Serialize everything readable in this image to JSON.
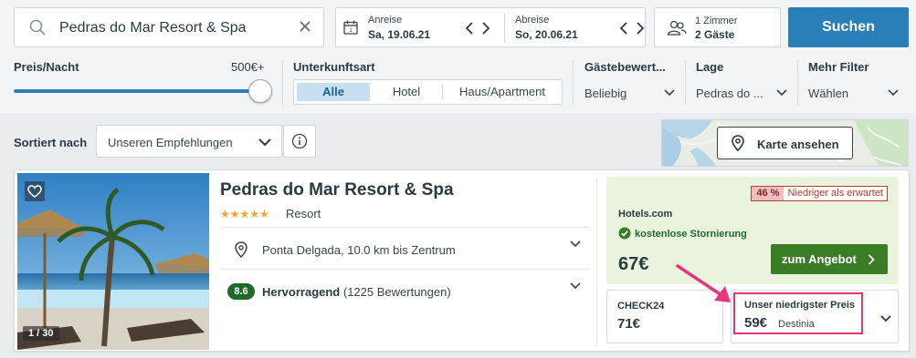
{
  "search": {
    "destination": "Pedras do Mar Resort & Spa",
    "checkin_label": "Anreise",
    "checkin_value": "Sa, 19.06.21",
    "checkout_label": "Abreise",
    "checkout_value": "So, 20.06.21",
    "rooms": "1 Zimmer",
    "guests": "2 Gäste",
    "button": "Suchen"
  },
  "filters": {
    "price_label": "Preis/Nacht",
    "price_value": "500€+",
    "price_level_percent": 100,
    "type_label": "Unterkunftsart",
    "type_options": [
      "Alle",
      "Hotel",
      "Haus/Apartment"
    ],
    "type_selected": "Alle",
    "rating_label": "Gästebewert...",
    "rating_value": "Beliebig",
    "location_label": "Lage",
    "location_value": "Pedras do ...",
    "more_label": "Mehr Filter",
    "more_value": "Wählen"
  },
  "results": {
    "sort_label": "Sortiert nach",
    "sort_value": "Unseren Empfehlungen",
    "map_button": "Karte ansehen"
  },
  "hotel": {
    "name": "Pedras do Mar Resort & Spa",
    "stars": "★★★★★",
    "type": "Resort",
    "location": "Ponta Delgada, 10.0 km bis Zentrum",
    "rating_score": "8.6",
    "rating_word": "Hervorragend",
    "rating_count": "(1225 Bewertungen)",
    "photo_count": "1 / 30",
    "deal_percent": "46 %",
    "deal_text": "Niedriger als erwartet",
    "best_provider": "Hotels.com",
    "best_cancellation": "kostenlose Stornierung",
    "best_price": "67€",
    "offer_button": "zum Angebot",
    "alt_provider": "CHECK24",
    "alt_price": "71€",
    "lowest_label": "Unser niedrigster Preis",
    "lowest_price": "59€",
    "lowest_provider": "Destinia"
  },
  "colors": {
    "accent": "#2a7fb8",
    "offer_green": "#3a7d26",
    "rating_green": "#1f6a2a",
    "highlight_pink": "#e8347a"
  }
}
